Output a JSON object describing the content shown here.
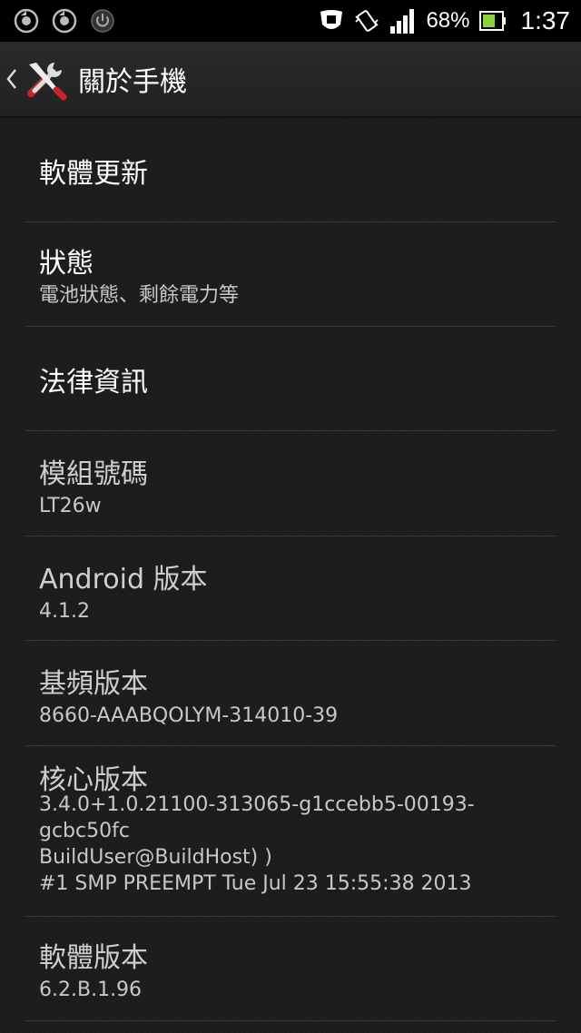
{
  "status_bar": {
    "battery_percent": "68%",
    "time": "1:37",
    "left_icons": [
      "sync-icon",
      "sync-icon",
      "power-icon"
    ],
    "right_icons": [
      "shield-icon",
      "vibrate-icon",
      "signal-icon",
      "battery-icon"
    ]
  },
  "action_bar": {
    "title": "關於手機"
  },
  "items": [
    {
      "title": "軟體更新"
    },
    {
      "title": "狀態",
      "summary": "電池狀態、剩餘電力等"
    },
    {
      "title": "法律資訊"
    },
    {
      "title": "模組號碼",
      "summary": "LT26w"
    },
    {
      "title": "Android 版本",
      "summary": "4.1.2"
    },
    {
      "title": "基頻版本",
      "summary": "8660-AAABQOLYM-314010-39"
    },
    {
      "title": "核心版本",
      "summary_lines": [
        "3.4.0+1.0.21100-313065-g1ccebb5-00193-",
        "gcbc50fc",
        "BuildUser@BuildHost) )",
        "#1 SMP PREEMPT Tue Jul 23 15:55:38 2013"
      ]
    },
    {
      "title": "軟體版本",
      "summary": "6.2.B.1.96"
    }
  ]
}
